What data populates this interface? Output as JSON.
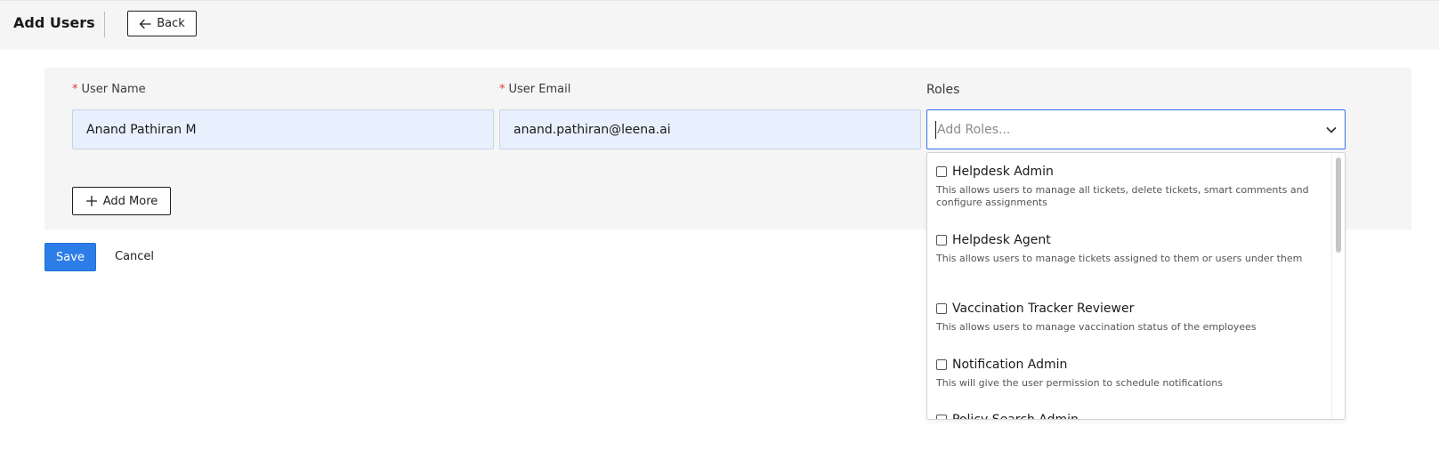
{
  "header": {
    "title": "Add Users",
    "back_label": "Back"
  },
  "form": {
    "user_name": {
      "label": "User Name",
      "required_mark": "*",
      "value": "Anand Pathiran M"
    },
    "user_email": {
      "label": "User Email",
      "required_mark": "*",
      "value": "anand.pathiran@leena.ai"
    },
    "roles": {
      "label": "Roles",
      "placeholder": "Add Roles...",
      "options": [
        {
          "title": "Helpdesk Admin",
          "description": "This allows users to manage all tickets, delete tickets, smart comments and configure assignments",
          "checked": false
        },
        {
          "title": "Helpdesk Agent",
          "description": "This allows users to manage tickets assigned to them or users under them",
          "checked": false
        },
        {
          "title": "Vaccination Tracker Reviewer",
          "description": "This allows users to manage vaccination status of the employees",
          "checked": false
        },
        {
          "title": "Notification Admin",
          "description": "This will give the user permission to schedule notifications",
          "checked": false
        },
        {
          "title": "Policy Search Admin",
          "description": "",
          "checked": false
        }
      ]
    },
    "add_more_label": "Add More"
  },
  "actions": {
    "save_label": "Save",
    "cancel_label": "Cancel"
  },
  "colors": {
    "primary": "#2d7de8",
    "required": "#e53935",
    "input_fill": "#e8f0fe",
    "focus_border": "#2d6ff0",
    "panel_bg": "#f5f5f5"
  },
  "icons": {
    "back": "arrow-left-icon",
    "add": "plus-icon",
    "dropdown": "chevron-down-icon"
  }
}
